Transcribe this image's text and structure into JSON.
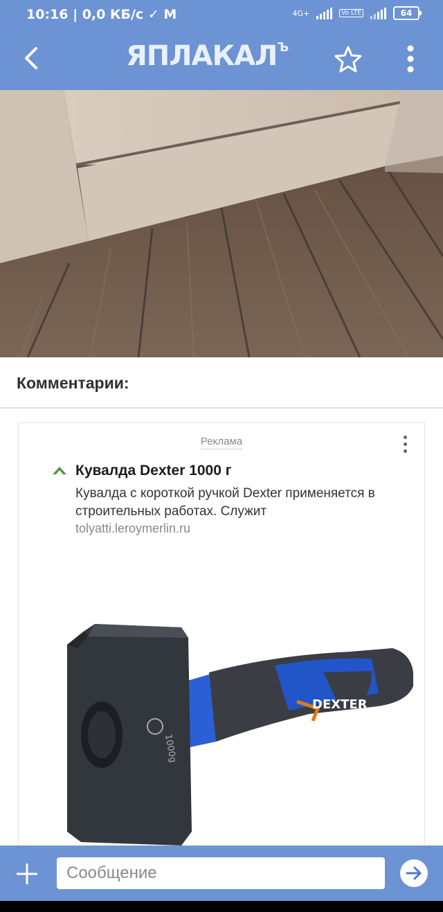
{
  "status_bar": {
    "time": "10:16",
    "network_speed": "0,0 КБ/с",
    "network_type": "4G+",
    "volte": "Vo LTE",
    "battery": "64",
    "icons": [
      "download-done-icon",
      "gmail-icon",
      "signal-icon",
      "signal-icon"
    ]
  },
  "app_bar": {
    "logo_text": "ЯПЛАКАЛ",
    "logo_suffix": "Ъ",
    "icons": [
      "back-arrow-icon",
      "star-icon",
      "more-vert-icon"
    ]
  },
  "comments": {
    "title": "Комментарии:"
  },
  "ad": {
    "label": "Реклама",
    "title": "Кувалда Dexter 1000 г",
    "description": "Кувалда с короткой ручкой Dexter  применяется в строительных работах. Служит",
    "url": "tolyatti.leroymerlin.ru",
    "product_brand": "DEXTER",
    "product_marking": "1000g"
  },
  "bottom_bar": {
    "message_placeholder": "Сообщение",
    "icons": [
      "plus-icon",
      "send-icon"
    ]
  },
  "colors": {
    "accent": "#6c93d3",
    "logo_green": "#4b9a3c"
  }
}
